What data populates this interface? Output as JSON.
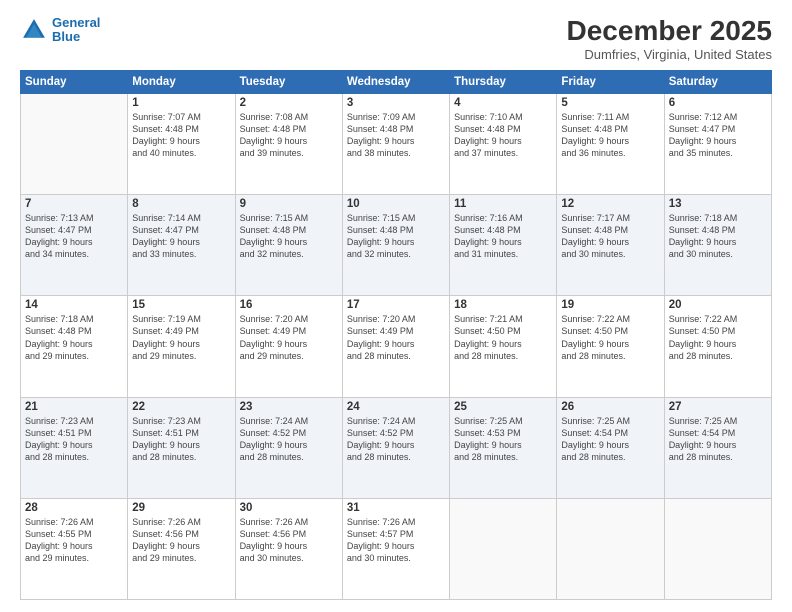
{
  "header": {
    "logo_line1": "General",
    "logo_line2": "Blue",
    "month": "December 2025",
    "location": "Dumfries, Virginia, United States"
  },
  "days_of_week": [
    "Sunday",
    "Monday",
    "Tuesday",
    "Wednesday",
    "Thursday",
    "Friday",
    "Saturday"
  ],
  "weeks": [
    [
      {
        "day": "",
        "info": ""
      },
      {
        "day": "1",
        "info": "Sunrise: 7:07 AM\nSunset: 4:48 PM\nDaylight: 9 hours\nand 40 minutes."
      },
      {
        "day": "2",
        "info": "Sunrise: 7:08 AM\nSunset: 4:48 PM\nDaylight: 9 hours\nand 39 minutes."
      },
      {
        "day": "3",
        "info": "Sunrise: 7:09 AM\nSunset: 4:48 PM\nDaylight: 9 hours\nand 38 minutes."
      },
      {
        "day": "4",
        "info": "Sunrise: 7:10 AM\nSunset: 4:48 PM\nDaylight: 9 hours\nand 37 minutes."
      },
      {
        "day": "5",
        "info": "Sunrise: 7:11 AM\nSunset: 4:48 PM\nDaylight: 9 hours\nand 36 minutes."
      },
      {
        "day": "6",
        "info": "Sunrise: 7:12 AM\nSunset: 4:47 PM\nDaylight: 9 hours\nand 35 minutes."
      }
    ],
    [
      {
        "day": "7",
        "info": "Sunrise: 7:13 AM\nSunset: 4:47 PM\nDaylight: 9 hours\nand 34 minutes."
      },
      {
        "day": "8",
        "info": "Sunrise: 7:14 AM\nSunset: 4:47 PM\nDaylight: 9 hours\nand 33 minutes."
      },
      {
        "day": "9",
        "info": "Sunrise: 7:15 AM\nSunset: 4:48 PM\nDaylight: 9 hours\nand 32 minutes."
      },
      {
        "day": "10",
        "info": "Sunrise: 7:15 AM\nSunset: 4:48 PM\nDaylight: 9 hours\nand 32 minutes."
      },
      {
        "day": "11",
        "info": "Sunrise: 7:16 AM\nSunset: 4:48 PM\nDaylight: 9 hours\nand 31 minutes."
      },
      {
        "day": "12",
        "info": "Sunrise: 7:17 AM\nSunset: 4:48 PM\nDaylight: 9 hours\nand 30 minutes."
      },
      {
        "day": "13",
        "info": "Sunrise: 7:18 AM\nSunset: 4:48 PM\nDaylight: 9 hours\nand 30 minutes."
      }
    ],
    [
      {
        "day": "14",
        "info": "Sunrise: 7:18 AM\nSunset: 4:48 PM\nDaylight: 9 hours\nand 29 minutes."
      },
      {
        "day": "15",
        "info": "Sunrise: 7:19 AM\nSunset: 4:49 PM\nDaylight: 9 hours\nand 29 minutes."
      },
      {
        "day": "16",
        "info": "Sunrise: 7:20 AM\nSunset: 4:49 PM\nDaylight: 9 hours\nand 29 minutes."
      },
      {
        "day": "17",
        "info": "Sunrise: 7:20 AM\nSunset: 4:49 PM\nDaylight: 9 hours\nand 28 minutes."
      },
      {
        "day": "18",
        "info": "Sunrise: 7:21 AM\nSunset: 4:50 PM\nDaylight: 9 hours\nand 28 minutes."
      },
      {
        "day": "19",
        "info": "Sunrise: 7:22 AM\nSunset: 4:50 PM\nDaylight: 9 hours\nand 28 minutes."
      },
      {
        "day": "20",
        "info": "Sunrise: 7:22 AM\nSunset: 4:50 PM\nDaylight: 9 hours\nand 28 minutes."
      }
    ],
    [
      {
        "day": "21",
        "info": "Sunrise: 7:23 AM\nSunset: 4:51 PM\nDaylight: 9 hours\nand 28 minutes."
      },
      {
        "day": "22",
        "info": "Sunrise: 7:23 AM\nSunset: 4:51 PM\nDaylight: 9 hours\nand 28 minutes."
      },
      {
        "day": "23",
        "info": "Sunrise: 7:24 AM\nSunset: 4:52 PM\nDaylight: 9 hours\nand 28 minutes."
      },
      {
        "day": "24",
        "info": "Sunrise: 7:24 AM\nSunset: 4:52 PM\nDaylight: 9 hours\nand 28 minutes."
      },
      {
        "day": "25",
        "info": "Sunrise: 7:25 AM\nSunset: 4:53 PM\nDaylight: 9 hours\nand 28 minutes."
      },
      {
        "day": "26",
        "info": "Sunrise: 7:25 AM\nSunset: 4:54 PM\nDaylight: 9 hours\nand 28 minutes."
      },
      {
        "day": "27",
        "info": "Sunrise: 7:25 AM\nSunset: 4:54 PM\nDaylight: 9 hours\nand 28 minutes."
      }
    ],
    [
      {
        "day": "28",
        "info": "Sunrise: 7:26 AM\nSunset: 4:55 PM\nDaylight: 9 hours\nand 29 minutes."
      },
      {
        "day": "29",
        "info": "Sunrise: 7:26 AM\nSunset: 4:56 PM\nDaylight: 9 hours\nand 29 minutes."
      },
      {
        "day": "30",
        "info": "Sunrise: 7:26 AM\nSunset: 4:56 PM\nDaylight: 9 hours\nand 30 minutes."
      },
      {
        "day": "31",
        "info": "Sunrise: 7:26 AM\nSunset: 4:57 PM\nDaylight: 9 hours\nand 30 minutes."
      },
      {
        "day": "",
        "info": ""
      },
      {
        "day": "",
        "info": ""
      },
      {
        "day": "",
        "info": ""
      }
    ]
  ]
}
